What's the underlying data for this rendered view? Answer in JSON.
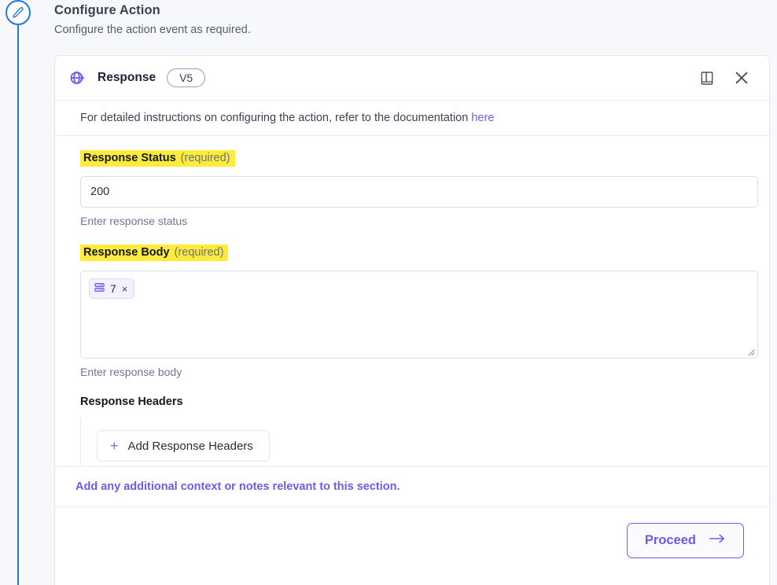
{
  "page": {
    "title": "Configure Action",
    "subtitle": "Configure the action event as required.",
    "step_icon": "pencil-edit-icon"
  },
  "card": {
    "logo_icon": "globe-arrow-icon",
    "title": "Response",
    "version_badge": "V5",
    "header_actions": [
      {
        "icon": "book-documentation-icon"
      },
      {
        "icon": "close-icon"
      }
    ],
    "doc_note": {
      "text": "For detailed instructions on configuring the action, refer to the documentation",
      "link_label": "here"
    },
    "fields": {
      "response_status": {
        "label": "Response Status",
        "required_text": "(required)",
        "value": "200",
        "placeholder": "",
        "helper": "Enter response status"
      },
      "response_body": {
        "label": "Response Body",
        "required_text": "(required)",
        "helper": "Enter response body",
        "chips": [
          {
            "icon": "database-icon",
            "label": "7",
            "remove_label": "×"
          }
        ]
      },
      "response_headers": {
        "label": "Response Headers",
        "add_button_label": "Add Response Headers",
        "add_button_icon": "plus-icon"
      }
    },
    "note_strip": "Add any additional context or notes relevant to this section.",
    "proceed_button": {
      "label": "Proceed",
      "icon": "arrow-right-icon"
    }
  },
  "colors": {
    "accent_purple": "#6c5ce7",
    "rail_blue": "#2176e8",
    "highlight_yellow": "#ffeb3b",
    "page_bg": "#f7f8fb"
  }
}
